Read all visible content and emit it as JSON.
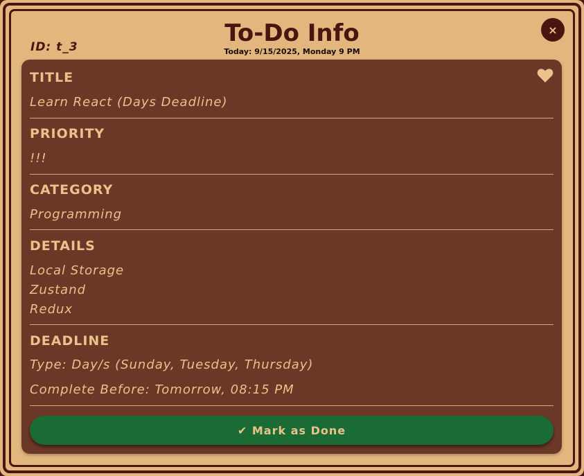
{
  "header": {
    "id_label": "ID: t_3",
    "title": "To-Do Info",
    "today": "Today: 9/15/2025, Monday 9 PM",
    "close_icon": "×"
  },
  "favorite_icon": "heart-icon",
  "sections": {
    "title": {
      "label": "TITLE",
      "value": "Learn React (Days Deadline)"
    },
    "priority": {
      "label": "PRIORITY",
      "value": "!!!"
    },
    "category": {
      "label": "CATEGORY",
      "value": "Programming"
    },
    "details": {
      "label": "DETAILS",
      "items": [
        "Local Storage",
        "Zustand",
        "Redux"
      ]
    },
    "deadline": {
      "label": "DEADLINE",
      "type": "Type: Day/s (Sunday, Tuesday, Thursday)",
      "complete_before": "Complete Before: Tomorrow, 08:15 PM"
    }
  },
  "actions": {
    "mark_done": "✔ Mark as Done"
  },
  "colors": {
    "background": "#e2b77e",
    "border": "#4a1410",
    "panel": "#6b3726",
    "text_light": "#e9c28c",
    "button": "#1b6b35"
  }
}
